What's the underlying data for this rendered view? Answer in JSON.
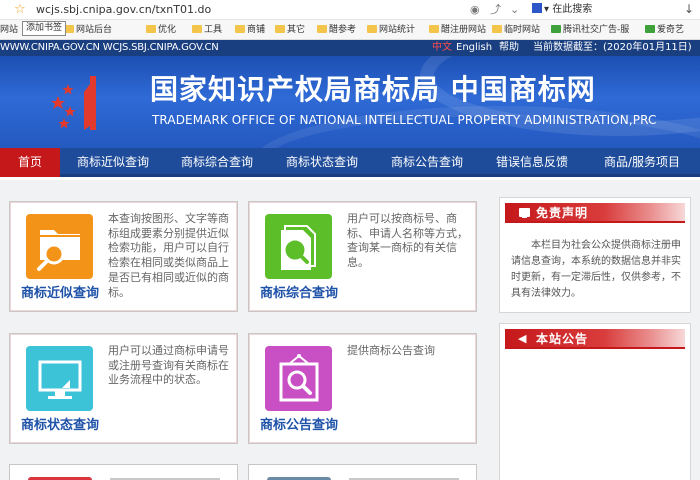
{
  "browser": {
    "url": "wcjs.sbj.cnipa.gov.cn/txnT01.do",
    "search_placeholder": "在此搜索",
    "tooltip": "添加书签"
  },
  "bookmarks": [
    "网站",
    "网站后台",
    "优化",
    "工具",
    "商铺",
    "其它",
    "醋参考",
    "网站统计",
    "醋注册网站",
    "临时网站",
    "腾讯社交广告-服",
    "爱奇艺"
  ],
  "topbar": {
    "domains": "WWW.CNIPA.GOV.CN WCJS.SBJ.CNIPA.GOV.CN",
    "lang_zh": "中文",
    "lang_en": "English",
    "help": "帮助",
    "date_label": "当前数据截至：(2020年01月11日)"
  },
  "banner": {
    "title_cn": "国家知识产权局商标局 中国商标网",
    "title_en": "TRADEMARK OFFICE OF NATIONAL INTELLECTUAL PROPERTY ADMINISTRATION,PRC"
  },
  "nav": [
    "首页",
    "商标近似查询",
    "商标综合查询",
    "商标状态查询",
    "商标公告查询",
    "错误信息反馈",
    "商品/服务项目"
  ],
  "cards": [
    {
      "title": "商标近似查询",
      "desc": "本查询按图形、文字等商标组成要素分别提供近似检索功能，用户可以自行检索在相同或类似商品上是否已有相同或近似的商标。",
      "color": "#f39318"
    },
    {
      "title": "商标综合查询",
      "desc": "用户可以按商标号、商标、申请人名称等方式，查询某一商标的有关信息。",
      "color": "#5cbf2a"
    },
    {
      "title": "商标状态查询",
      "desc": "用户可以通过商标申请号或注册号查询有关商标在业务流程中的状态。",
      "color": "#3cc3d8"
    },
    {
      "title": "商标公告查询",
      "desc": "提供商标公告查询",
      "color": "#c84fc4"
    }
  ],
  "sidebar": {
    "disclaimer_title": "免责声明",
    "disclaimer_text": "本栏目为社会公众提供商标注册申请信息查询，本系统的数据信息并非实时更新，有一定滞后性，仅供参考，不具有法律效力。",
    "notice_title": "本站公告"
  }
}
